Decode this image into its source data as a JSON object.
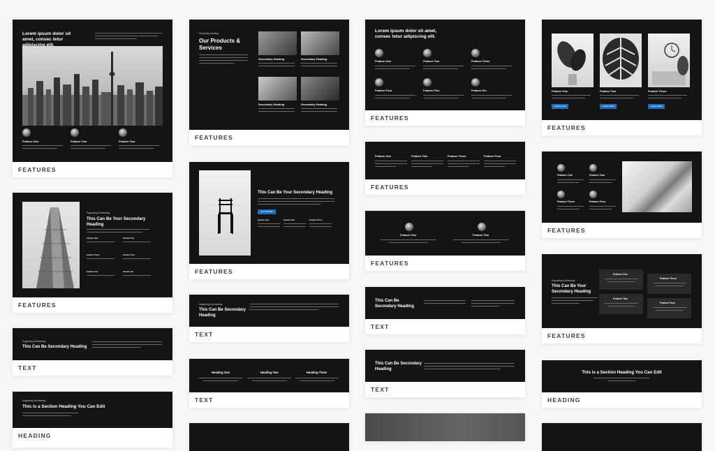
{
  "labels": {
    "features": "FEATURES",
    "text": "TEXT",
    "heading": "HEADING"
  },
  "c1": {
    "title": "Lorem ipsum dolor sit amet, consec tetur adipiscing elit.",
    "f1": "Feature One",
    "f2": "Feature Two",
    "f3": "Feature Two"
  },
  "c2": {
    "eyebrow": "Supporting Subheading",
    "title": "This Can Be Your Secondary Heading",
    "items": [
      "Feature One",
      "Feature Two",
      "Feature Three",
      "Feature Four",
      "Feature Five",
      "Feature Six"
    ]
  },
  "c3": {
    "eyebrow": "Supporting Subheading",
    "title": "This Can Be Secondary Heading"
  },
  "c4": {
    "eyebrow": "Supporting Subheading",
    "title": "This is a Section Heading You Can Edit"
  },
  "c5": {
    "eyebrow": "Secondary Heading",
    "title": "Our Products & Services",
    "h1": "Secondary Heading",
    "h2": "Secondary Heading",
    "h3": "Secondary Heading",
    "h4": "Secondary Heading"
  },
  "c6": {
    "title": "This Can Be Your Secondary Heading",
    "button": "GET STARTED",
    "f1": "Feature One",
    "f2": "Feature Two",
    "f3": "Feature Three"
  },
  "c7": {
    "eyebrow": "Supporting Subheading",
    "title": "This Can Be Secondary Heading"
  },
  "c8": {
    "h1": "Heading One",
    "h2": "Heading Two",
    "h3": "Heading Three"
  },
  "c9": {
    "title": "Lorem ipsum dolor sit amet, consec tetur adipiscing elit.",
    "items": [
      "Feature One",
      "Feature Two",
      "Feature Three",
      "Feature Four",
      "Feature Five",
      "Feature Six"
    ]
  },
  "c10": {
    "items": [
      "Feature One",
      "Feature Two",
      "Feature Three",
      "Feature Four"
    ]
  },
  "c11": {
    "f1": "Feature One",
    "f2": "Feature Two"
  },
  "c12": {
    "title": "This Can Be Secondary Heading"
  },
  "c13": {
    "title": "This Can Be Secondary Heading"
  },
  "c15": {
    "f1": "Feature One",
    "f2": "Feature Two",
    "f3": "Feature Three",
    "button": "LEARN MORE"
  },
  "c16": {
    "items": [
      "Feature One",
      "Feature Two",
      "Feature Three",
      "Feature Four"
    ]
  },
  "c17": {
    "eyebrow": "Supporting Subheading",
    "title": "This Can Be Your Secondary Heading",
    "f1": "Feature One",
    "f2": "Feature Two",
    "f3": "Feature Three",
    "f4": "Feature Four"
  },
  "c18": {
    "title": "This is a Section Heading You Can Edit"
  }
}
